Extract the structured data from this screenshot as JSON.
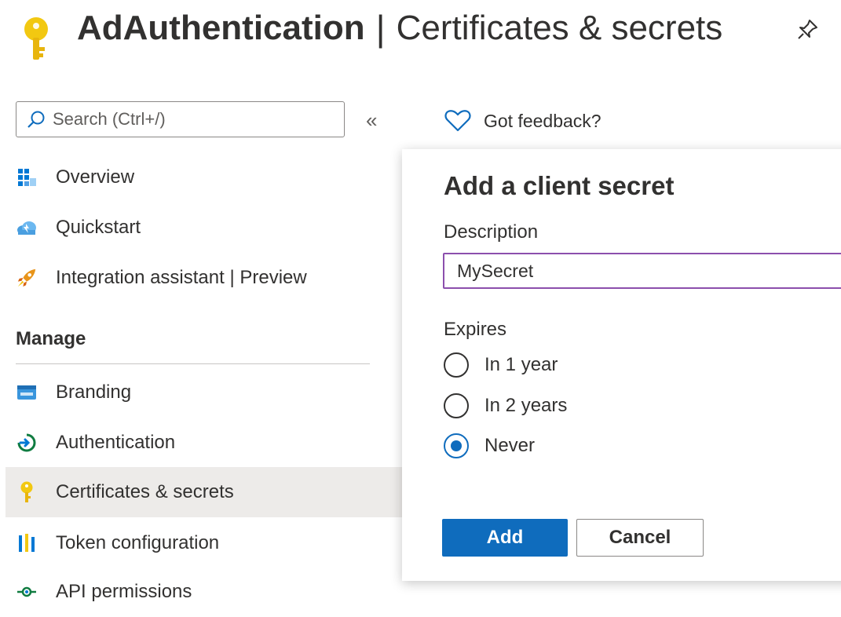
{
  "header": {
    "app_name": "AdAuthentication",
    "separator": "|",
    "page_title": "Certificates & secrets",
    "icon": "key-icon",
    "pin_icon": "pin-icon"
  },
  "search": {
    "placeholder": "Search (Ctrl+/)",
    "value": "",
    "icon": "search-icon"
  },
  "collapse": {
    "label": "«"
  },
  "feedback": {
    "label": "Got feedback?",
    "icon": "heart-icon"
  },
  "sidebar": {
    "items": [
      {
        "label": "Overview",
        "icon": "overview-grid-icon"
      },
      {
        "label": "Quickstart",
        "icon": "quickstart-cloud-icon"
      },
      {
        "label": "Integration assistant | Preview",
        "icon": "rocket-icon"
      }
    ],
    "manage": {
      "heading": "Manage",
      "items": [
        {
          "label": "Branding",
          "icon": "branding-icon"
        },
        {
          "label": "Authentication",
          "icon": "authentication-icon"
        },
        {
          "label": "Certificates & secrets",
          "icon": "key-icon",
          "selected": true
        },
        {
          "label": "Token configuration",
          "icon": "token-bars-icon"
        },
        {
          "label": "API permissions",
          "icon": "api-permissions-icon"
        }
      ]
    }
  },
  "dialog": {
    "title": "Add a client secret",
    "description_label": "Description",
    "description_value": "MySecret",
    "expires_label": "Expires",
    "options": [
      {
        "label": "In 1 year",
        "checked": false
      },
      {
        "label": "In 2 years",
        "checked": false
      },
      {
        "label": "Never",
        "checked": true
      }
    ],
    "add_label": "Add",
    "cancel_label": "Cancel"
  },
  "colors": {
    "accent": "#0f6cbd",
    "input_border_focus": "#8c4fad",
    "selected_bg": "#edebe9",
    "key_gold": "#f2c811"
  }
}
